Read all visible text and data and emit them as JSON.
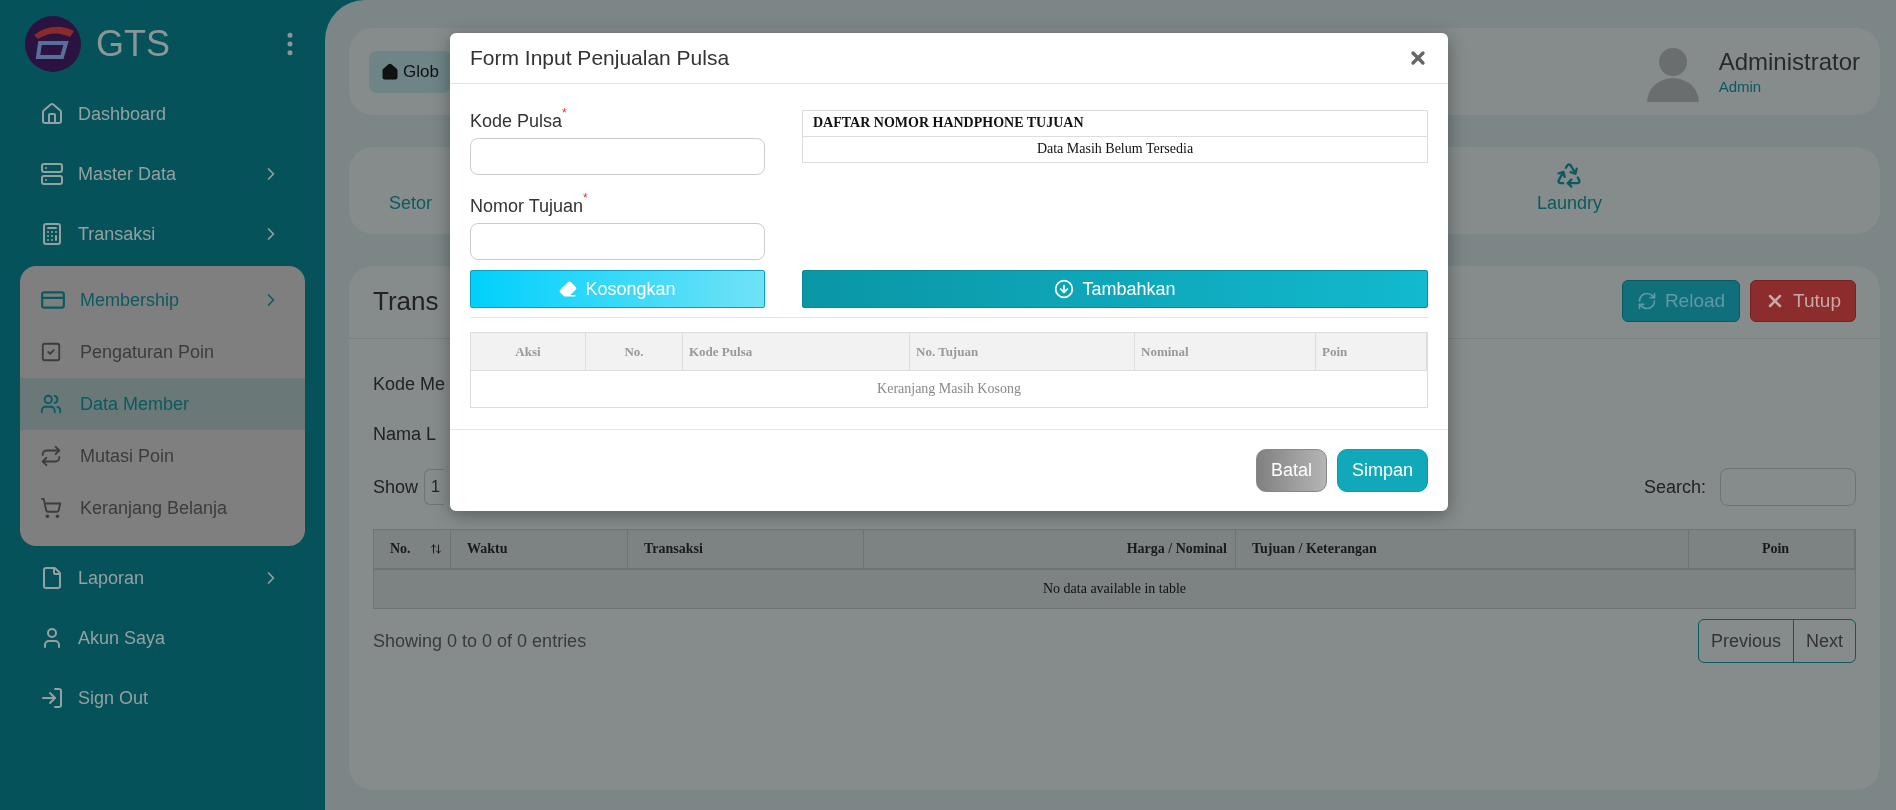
{
  "sidebar": {
    "brand": "GTS",
    "items": [
      {
        "label": "Dashboard",
        "has_submenu": false,
        "expanded": false
      },
      {
        "label": "Master Data",
        "has_submenu": true,
        "expanded": false
      },
      {
        "label": "Transaksi",
        "has_submenu": true,
        "expanded": false
      },
      {
        "label": "Membership",
        "has_submenu": true,
        "expanded": true,
        "children": [
          {
            "label": "Pengaturan Poin",
            "selected": false
          },
          {
            "label": "Data Member",
            "selected": true
          },
          {
            "label": "Mutasi Poin",
            "selected": false
          },
          {
            "label": "Keranjang Belanja",
            "selected": false
          }
        ]
      },
      {
        "label": "Laporan",
        "has_submenu": true,
        "expanded": false
      },
      {
        "label": "Akun Saya",
        "has_submenu": false,
        "expanded": false
      },
      {
        "label": "Sign Out",
        "has_submenu": false,
        "expanded": false
      }
    ]
  },
  "header": {
    "global_button": "Glob",
    "user": {
      "name": "Administrator",
      "role": "Admin"
    }
  },
  "shortcuts": [
    "Setor",
    "Laundry"
  ],
  "panel": {
    "title": "Trans",
    "buttons": [
      {
        "label": "Reload",
        "kind": "reload"
      },
      {
        "label": "Tutup",
        "kind": "close"
      }
    ],
    "fields": [
      "Kode Me",
      "Nama L"
    ],
    "length_label": "Show",
    "length_value": "1",
    "search_label": "Search:",
    "table": {
      "columns": [
        "No.",
        "Waktu",
        "Transaksi",
        "Harga / Nominal",
        "Tujuan / Keterangan",
        "Poin"
      ],
      "empty": "No data available in table"
    },
    "info": "Showing 0 to 0 of 0 entries",
    "pagination": [
      "Previous",
      "Next"
    ]
  },
  "modal": {
    "title": "Form Input Penjualan Pulsa",
    "fields": [
      {
        "label": "Kode Pulsa",
        "required_mark": "*"
      },
      {
        "label": "Nomor Tujuan",
        "required_mark": "*"
      }
    ],
    "phone_list": {
      "title": "DAFTAR NOMOR HANDPHONE TUJUAN",
      "empty": "Data Masih Belum Tersedia"
    },
    "actions": [
      {
        "label": "Kosongkan",
        "kind": "clear"
      },
      {
        "label": "Tambahkan",
        "kind": "add"
      }
    ],
    "cart": {
      "columns": [
        "Aksi",
        "No.",
        "Kode Pulsa",
        "No. Tujuan",
        "Nominal",
        "Poin"
      ],
      "empty": "Keranjang Masih Kosong"
    },
    "footer_buttons": [
      {
        "label": "Batal",
        "kind": "cancel"
      },
      {
        "label": "Simpan",
        "kind": "save"
      }
    ]
  }
}
